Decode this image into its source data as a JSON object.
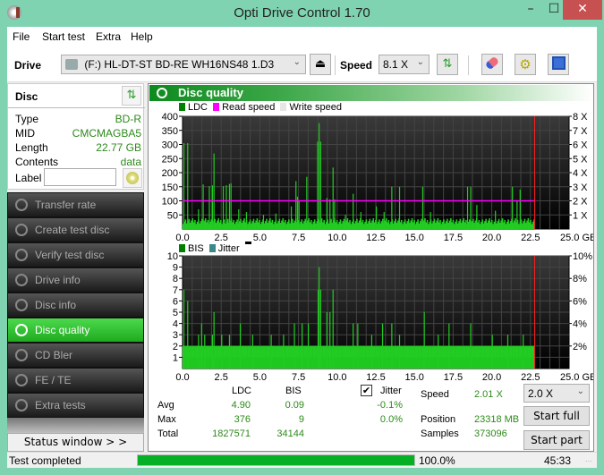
{
  "window": {
    "title": "Opti Drive Control 1.70",
    "min": "–",
    "max": "☐",
    "close": "✕"
  },
  "menu": [
    "File",
    "Start test",
    "Extra",
    "Help"
  ],
  "toolbar": {
    "drive_label": "Drive",
    "drive_value": "(F:)  HL-DT-ST BD-RE  WH16NS48 1.D3",
    "speed_label": "Speed",
    "speed_value": "8.1 X",
    "icons": [
      "eject-icon",
      "refresh-icon",
      "erase-icon",
      "settings-icon",
      "save-icon"
    ]
  },
  "disc": {
    "heading": "Disc",
    "fields": [
      {
        "key": "Type",
        "value": "BD-R"
      },
      {
        "key": "MID",
        "value": "CMCMAGBA5"
      },
      {
        "key": "Length",
        "value": "22.77 GB"
      },
      {
        "key": "Contents",
        "value": "data"
      }
    ],
    "label_key": "Label",
    "label_value": ""
  },
  "nav": [
    {
      "label": "Transfer rate",
      "active": false
    },
    {
      "label": "Create test disc",
      "active": false
    },
    {
      "label": "Verify test disc",
      "active": false
    },
    {
      "label": "Drive info",
      "active": false
    },
    {
      "label": "Disc info",
      "active": false
    },
    {
      "label": "Disc quality",
      "active": true
    },
    {
      "label": "CD Bler",
      "active": false
    },
    {
      "label": "FE / TE",
      "active": false
    },
    {
      "label": "Extra tests",
      "active": false
    }
  ],
  "status_window_button": "Status window > >",
  "panel": {
    "title": "Disc quality"
  },
  "colors": {
    "ldc": "#008000",
    "read_speed": "#ff00ff",
    "write_speed": "#e0e0e0",
    "bis": "#008000",
    "jitter": "#3a8a8a",
    "bars": "#22cc22",
    "end_marker": "#ff2020"
  },
  "chart_data": [
    {
      "type": "bar",
      "title": "LDC",
      "legend": [
        "LDC",
        "Read speed",
        "Write speed"
      ],
      "legend_placement": "top-left",
      "xlabel": "GB",
      "x_ticks": [
        "0.0",
        "2.5",
        "5.0",
        "7.5",
        "10.0",
        "12.5",
        "15.0",
        "17.5",
        "20.0",
        "22.5",
        "25.0 GB"
      ],
      "y_ticks": [
        "400",
        "350",
        "300",
        "250",
        "200",
        "150",
        "100",
        "50"
      ],
      "y2_ticks": [
        "8 X",
        "7 X",
        "6 X",
        "5 X",
        "4 X",
        "3 X",
        "2 X",
        "1 X"
      ],
      "xlim": [
        0,
        25
      ],
      "ylim": [
        0,
        400
      ],
      "y2lim": [
        0,
        8
      ],
      "grid": true,
      "end_position_gb": 22.77,
      "read_speed_x": 2.0,
      "baseline_ldc": 18,
      "spikes": [
        [
          0.05,
          305
        ],
        [
          0.3,
          305
        ],
        [
          1.0,
          70
        ],
        [
          1.3,
          158
        ],
        [
          1.7,
          152
        ],
        [
          1.9,
          155
        ],
        [
          2.0,
          268
        ],
        [
          2.6,
          152
        ],
        [
          2.8,
          155
        ],
        [
          3.0,
          160
        ],
        [
          3.1,
          162
        ],
        [
          3.6,
          70
        ],
        [
          4.1,
          60
        ],
        [
          5.2,
          50
        ],
        [
          6.0,
          55
        ],
        [
          7.0,
          80
        ],
        [
          7.3,
          170
        ],
        [
          7.4,
          115
        ],
        [
          7.5,
          100
        ],
        [
          8.0,
          185
        ],
        [
          8.7,
          310
        ],
        [
          8.8,
          376
        ],
        [
          8.9,
          310
        ],
        [
          9.3,
          110
        ],
        [
          9.5,
          105
        ],
        [
          9.7,
          218
        ],
        [
          9.8,
          105
        ],
        [
          10.5,
          50
        ],
        [
          11.0,
          125
        ],
        [
          11.5,
          60
        ],
        [
          12.5,
          80
        ],
        [
          13.0,
          60
        ],
        [
          13.5,
          150
        ],
        [
          14.0,
          150
        ],
        [
          15.5,
          150
        ],
        [
          16.0,
          60
        ],
        [
          18.4,
          150
        ],
        [
          18.6,
          150
        ],
        [
          19.0,
          85
        ],
        [
          20.2,
          65
        ],
        [
          21.3,
          150
        ],
        [
          21.6,
          100
        ],
        [
          21.8,
          140
        ]
      ]
    },
    {
      "type": "bar",
      "title": "BIS",
      "legend": [
        "BIS",
        "Jitter"
      ],
      "legend_placement": "top-left",
      "xlabel": "GB",
      "x_ticks": [
        "0.0",
        "2.5",
        "5.0",
        "7.5",
        "10.0",
        "12.5",
        "15.0",
        "17.5",
        "20.0",
        "22.5",
        "25.0 GB"
      ],
      "y_ticks": [
        "10",
        "9",
        "8",
        "7",
        "6",
        "5",
        "4",
        "3",
        "2",
        "1"
      ],
      "y2_ticks": [
        "10%",
        "8%",
        "6%",
        "4%",
        "2%"
      ],
      "xlim": [
        0,
        25
      ],
      "ylim": [
        0,
        10
      ],
      "y2lim": [
        0,
        10
      ],
      "grid": true,
      "end_position_gb": 22.77,
      "baseline_bis": 2,
      "spikes": [
        [
          0.05,
          7
        ],
        [
          0.3,
          6
        ],
        [
          1.0,
          3
        ],
        [
          1.2,
          4
        ],
        [
          1.4,
          3
        ],
        [
          1.9,
          3
        ],
        [
          2.0,
          5
        ],
        [
          2.5,
          3
        ],
        [
          3.0,
          3
        ],
        [
          3.7,
          4
        ],
        [
          4.5,
          3
        ],
        [
          5.7,
          3
        ],
        [
          6.5,
          3
        ],
        [
          7.2,
          4
        ],
        [
          7.7,
          4
        ],
        [
          8.1,
          4
        ],
        [
          8.75,
          7
        ],
        [
          8.8,
          9
        ],
        [
          8.9,
          7
        ],
        [
          9.3,
          5
        ],
        [
          9.5,
          5
        ],
        [
          9.7,
          7
        ],
        [
          11.0,
          4
        ],
        [
          11.3,
          4
        ],
        [
          12.2,
          3
        ],
        [
          12.9,
          4
        ],
        [
          13.5,
          4
        ],
        [
          14.0,
          3
        ],
        [
          15.6,
          5
        ],
        [
          16.5,
          3
        ],
        [
          17.2,
          4
        ],
        [
          18.6,
          4
        ],
        [
          20.0,
          3
        ],
        [
          21.0,
          3
        ],
        [
          22.0,
          3
        ]
      ]
    }
  ],
  "stats": {
    "headers": {
      "ldc": "LDC",
      "bis": "BIS",
      "jitter": "Jitter"
    },
    "jitter_checked": true,
    "rows": [
      {
        "label": "Avg",
        "ldc": "4.90",
        "bis": "0.09",
        "jitter": "-0.1%"
      },
      {
        "label": "Max",
        "ldc": "376",
        "bis": "9",
        "jitter": "0.0%"
      },
      {
        "label": "Total",
        "ldc": "1827571",
        "bis": "34144",
        "jitter": ""
      }
    ],
    "speed_label": "Speed",
    "speed_value": "2.01 X",
    "position_label": "Position",
    "position_value": "23318 MB",
    "samples_label": "Samples",
    "samples_value": "373096",
    "speed_select": "2.0 X",
    "start_full": "Start full",
    "start_part": "Start part"
  },
  "statusbar": {
    "text": "Test completed",
    "progress": 1.0,
    "percent": "100.0%",
    "time": "45:33"
  }
}
